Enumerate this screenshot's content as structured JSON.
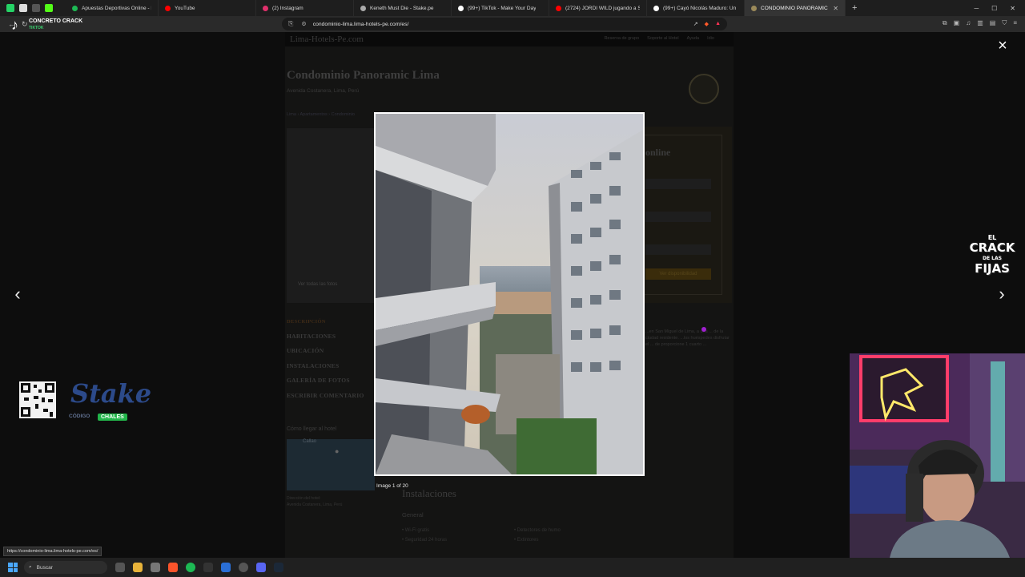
{
  "browser": {
    "tabs": [
      {
        "label": "Apuestas Deportivas Online - Fútbol",
        "fav": "#1db954"
      },
      {
        "label": "YouTube",
        "fav": "#ff0000"
      },
      {
        "label": "(2) Instagram",
        "fav": "#e1306c"
      },
      {
        "label": "Keneth Must Die - Stake.pe",
        "fav": "#aaaaaa"
      },
      {
        "label": "(99+) TikTok - Make Your Day",
        "fav": "#ffffff"
      },
      {
        "label": "(2724) JORDI WILD jugando a SAD S...",
        "fav": "#ff0000"
      },
      {
        "label": "(99+) Cayó Nicolás Maduro: Un Cam...",
        "fav": "#ffffff"
      },
      {
        "label": "CONDOMINIO PANORAMIC LIM...",
        "fav": "#9b8a5a"
      }
    ],
    "active_tab_index": 7,
    "url": "condominio-lima.lima-hotels-pe.com/es/",
    "overlay_logo": {
      "title": "CONCRETO CRACK",
      "sub": "TIKTOK"
    }
  },
  "site": {
    "brand": "Lima-Hotels-Pe.com",
    "links": [
      "Reserva de grupo",
      "Soporte al Hotel",
      "Ayuda",
      "Idio"
    ],
    "title": "Condominio Panoramic Lima",
    "address": "Avenida Costanera, Lima, Perú",
    "breadcrumbs": "Lima › Apartamentos › Condominio",
    "see_all": "Ver todas las fotos",
    "booking_title": "online",
    "booking_button": "Ver disponibilidad",
    "menu": [
      "DESCRIPCIÓN",
      "HABITACIONES",
      "UBICACIÓN",
      "INSTALACIONES",
      "GALERÍA DE FOTOS",
      "ESCRIBIR COMENTARIO"
    ],
    "map_title": "Cómo llegar al hotel",
    "map_label": "Callao",
    "map_addr_label": "Dirección del hotel:",
    "map_addr": "Avenida Costanera, Lima, Perú",
    "description": "...en San Miguel de Lima, a una ... de la ciudad residente. ...los huéspedes disfrutar el ... de proporcione 1 cuarto ...",
    "facilities_title": "Instalaciones",
    "facilities_sub": "General",
    "facilities_col1": [
      "• Wi-Fi gratis",
      "• Seguridad 24 horas"
    ],
    "facilities_col2": [
      "• Detectores de humo",
      "• Extintores"
    ]
  },
  "lightbox": {
    "caption": "Image 1 of 20",
    "close_glyph": "×",
    "prev_glyph": "‹",
    "next_glyph": "›"
  },
  "overlays": {
    "stake_word": "Stake",
    "stake_code_label": "CÓDIGO",
    "stake_code": "CHALES",
    "crack_lines": [
      "EL",
      "CRACK",
      "DE LAS",
      "FIJAS"
    ]
  },
  "status_url": "https://condominio-lima.lima-hotels-pe.com/es/",
  "taskbar": {
    "search_placeholder": "Buscar"
  }
}
